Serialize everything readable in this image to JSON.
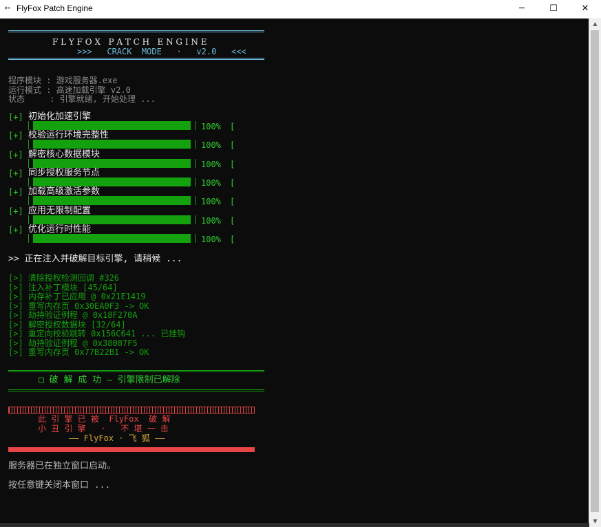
{
  "window": {
    "title": "FlyFox Patch Engine"
  },
  "header": {
    "title": "F L Y F O X   P A T C H   E N G I N E",
    "subtitle": ">>>   CRACK  MODE   ·   v2.0   <<<"
  },
  "info": [
    "程序模块 : 游戏服务器.exe",
    "运行模式 : 高速加载引擎 v2.0",
    "状态     : 引擎就绪, 开始处理 ..."
  ],
  "tasks": [
    {
      "prefix": "[+]",
      "label": "初始化加速引擎",
      "percent_text": "100%",
      "progress": 1.0,
      "tail": "["
    },
    {
      "prefix": "[+]",
      "label": "校验运行环境完整性",
      "percent_text": "100%",
      "progress": 1.0,
      "tail": "["
    },
    {
      "prefix": "[+]",
      "label": "解密核心数据模块",
      "percent_text": "100%",
      "progress": 1.0,
      "tail": "["
    },
    {
      "prefix": "[+]",
      "label": "同步授权服务节点",
      "percent_text": "100%",
      "progress": 1.0,
      "tail": "["
    },
    {
      "prefix": "[+]",
      "label": "加载高级激活参数",
      "percent_text": "100%",
      "progress": 1.0,
      "tail": "["
    },
    {
      "prefix": "[+]",
      "label": "应用无限制配置",
      "percent_text": "100%",
      "progress": 1.0,
      "tail": "["
    },
    {
      "prefix": "[+]",
      "label": "优化运行时性能",
      "percent_text": "100%",
      "progress": 1.0,
      "tail": "["
    }
  ],
  "injecting": ">> 正在注入并破解目标引擎, 请稍候 ...",
  "log": [
    "[>] 清除授权检测回调 #326",
    "[>] 注入补丁模块 [45/64]",
    "[>] 内存补丁已应用 @ 0x21E1419",
    "[>] 重写内存页 0x30EA0F3 -> OK",
    "[>] 劫持验证例程 @ 0x18F270A",
    "[>] 解密授权数据块 [32/64]",
    "[>] 重定向校验跳转 0x156C641 ... 已挂钩",
    "[>] 劫持验证例程 @ 0x38087F5",
    "[>] 重写内存页 0x77B22B1 -> OK"
  ],
  "success": "□ 破 解 成 功 — 引擎限制已解除",
  "banner": {
    "line1": "此 引 擎 已 被  FlyFox  破 解",
    "line2": "小 丑 引 擎   ·   不 堪 一 击",
    "line3": "—— FlyFox · 飞 狐 ——"
  },
  "footer": {
    "server_started": "服务器已在独立窗口启动。",
    "press_key": "按任意键关闭本窗口 ..."
  },
  "colors": {
    "green": "#13a10e",
    "cyan": "#6fb9d9",
    "red": "#e64545",
    "yellow": "#d6a83a"
  }
}
